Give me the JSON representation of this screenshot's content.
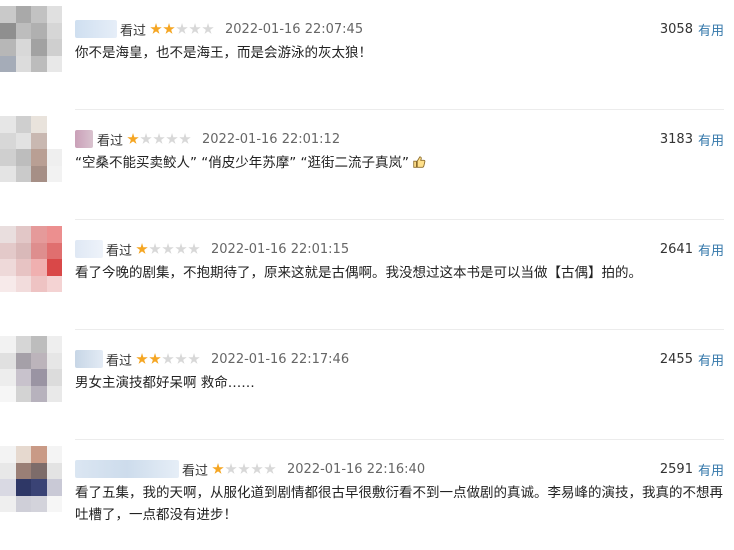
{
  "colors": {
    "star_on": "#f5a623",
    "star_off": "#d8d8d8",
    "useful_link": "#3377aa"
  },
  "reviews": [
    {
      "status": "看过",
      "rating": 2,
      "time": "2022-01-16 22:07:45",
      "votes": "3058",
      "useful": "有用",
      "content": "你不是海皇，也不是海王，而是会游泳的灰太狼！",
      "emoji": ""
    },
    {
      "status": "看过",
      "rating": 1,
      "time": "2022-01-16 22:01:12",
      "votes": "3183",
      "useful": "有用",
      "content": "“空桑不能买卖鲛人” “俏皮少年苏摩” “逛街二流子真岚”",
      "emoji": "thumbs-up-icon"
    },
    {
      "status": "看过",
      "rating": 1,
      "time": "2022-01-16 22:01:15",
      "votes": "2641",
      "useful": "有用",
      "content": "看了今晚的剧集，不抱期待了，原来这就是古偶啊。我没想过这本书是可以当做【古偶】拍的。",
      "emoji": ""
    },
    {
      "status": "看过",
      "rating": 2,
      "time": "2022-01-16 22:17:46",
      "votes": "2455",
      "useful": "有用",
      "content": "男女主演技都好呆啊 救命……",
      "emoji": ""
    },
    {
      "status": "看过",
      "rating": 1,
      "time": "2022-01-16 22:16:40",
      "votes": "2591",
      "useful": "有用",
      "content": "看了五集，我的天啊，从服化道到剧情都很古早很敷衍看不到一点做剧的真诚。李易峰的演技，我真的不想再吐槽了，一点都没有进步！",
      "emoji": ""
    }
  ]
}
